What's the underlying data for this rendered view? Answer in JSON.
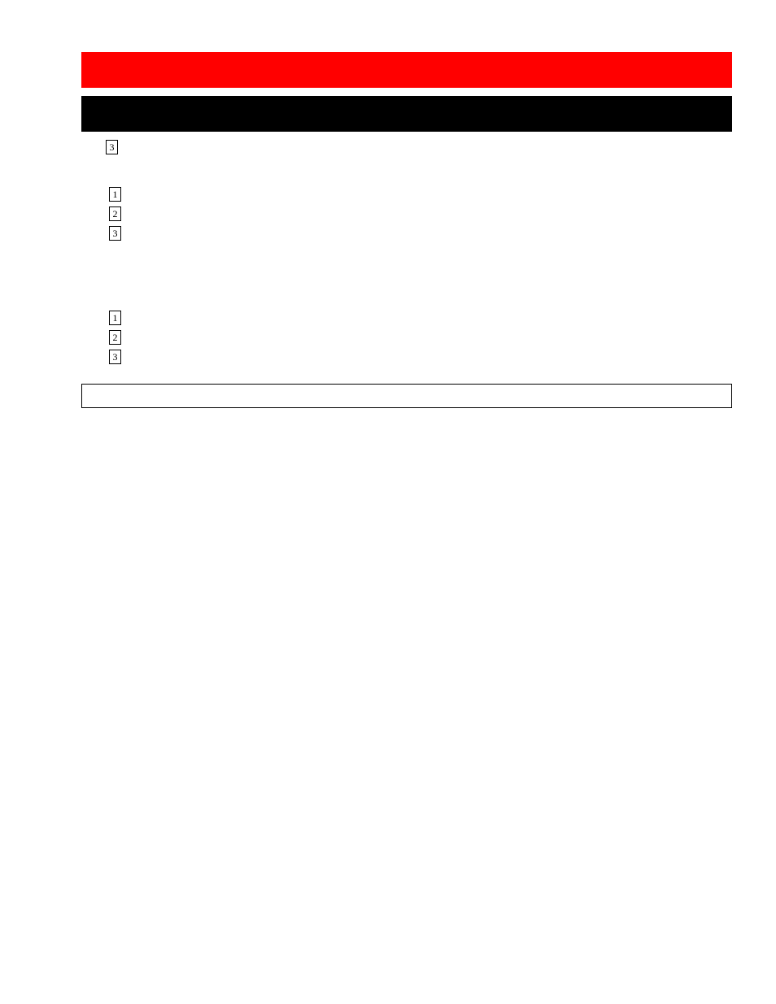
{
  "topItem": {
    "num": "3",
    "text": ""
  },
  "listA": [
    {
      "num": "1",
      "text": ""
    },
    {
      "num": "2",
      "text": ""
    },
    {
      "num": "3",
      "text": ""
    }
  ],
  "listB": [
    {
      "num": "1",
      "text": ""
    },
    {
      "num": "2",
      "text": ""
    },
    {
      "num": "3",
      "text": ""
    }
  ],
  "boxText": ""
}
